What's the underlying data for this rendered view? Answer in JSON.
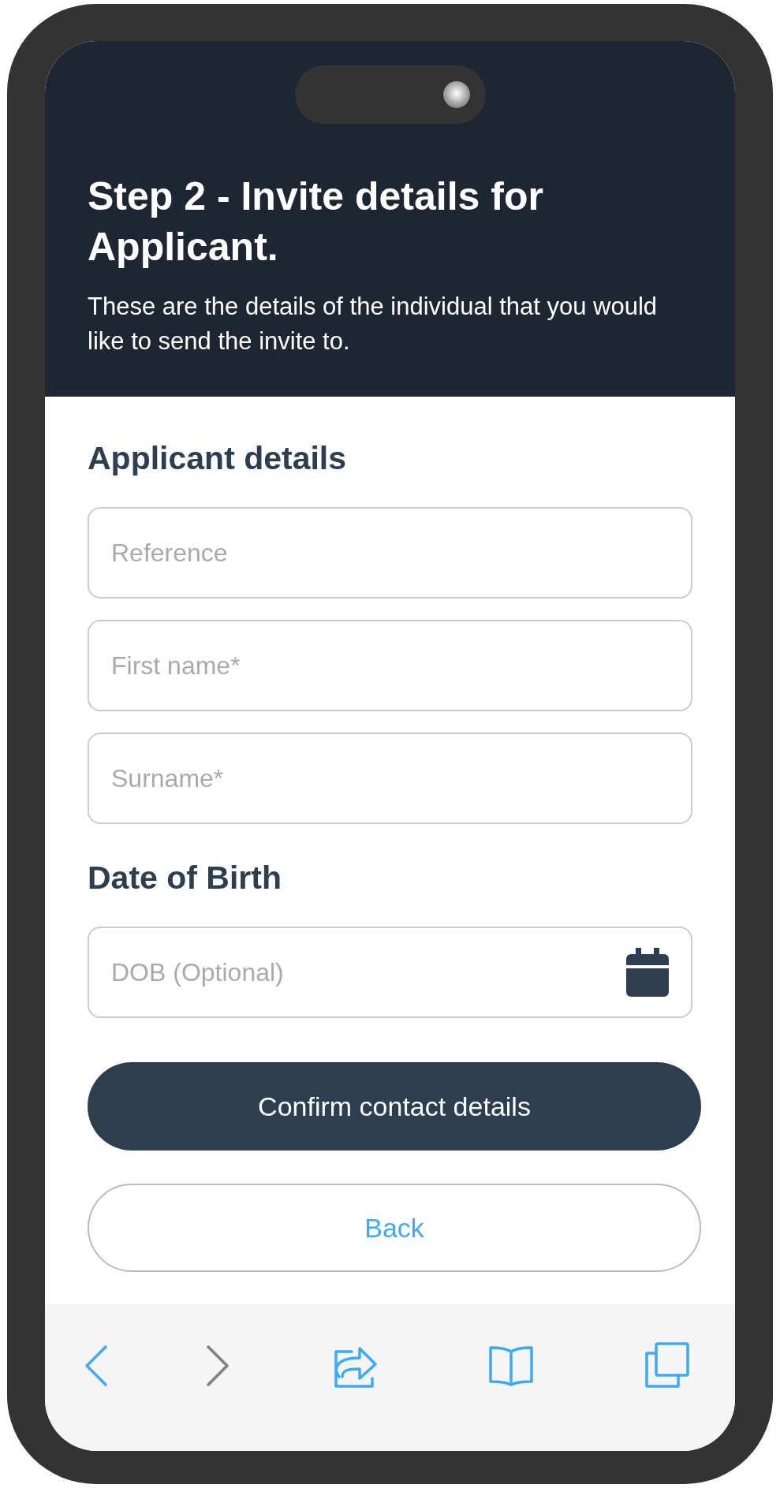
{
  "header": {
    "title": "Step 2 - Invite details for Applicant.",
    "subtitle": "These are the details of the individual that you would like to send the invite to."
  },
  "sections": [
    {
      "heading": "Applicant details",
      "fields": [
        {
          "placeholder": "Reference",
          "kind": "text"
        },
        {
          "placeholder": "First name*",
          "kind": "text"
        },
        {
          "placeholder": "Surname*",
          "kind": "text"
        }
      ]
    },
    {
      "heading": "Date of Birth",
      "fields": [
        {
          "placeholder": "DOB (Optional)",
          "kind": "date"
        }
      ]
    }
  ],
  "buttons": [
    {
      "label": "Confirm contact details",
      "kind": "primary"
    },
    {
      "label": "Back",
      "kind": "secondary"
    }
  ],
  "toolbar": [
    {
      "kind": "back",
      "disabled": false
    },
    {
      "kind": "forward",
      "disabled": true
    },
    {
      "kind": "share",
      "disabled": false
    },
    {
      "kind": "bookmarks",
      "disabled": false
    },
    {
      "kind": "tabs",
      "disabled": false
    }
  ]
}
